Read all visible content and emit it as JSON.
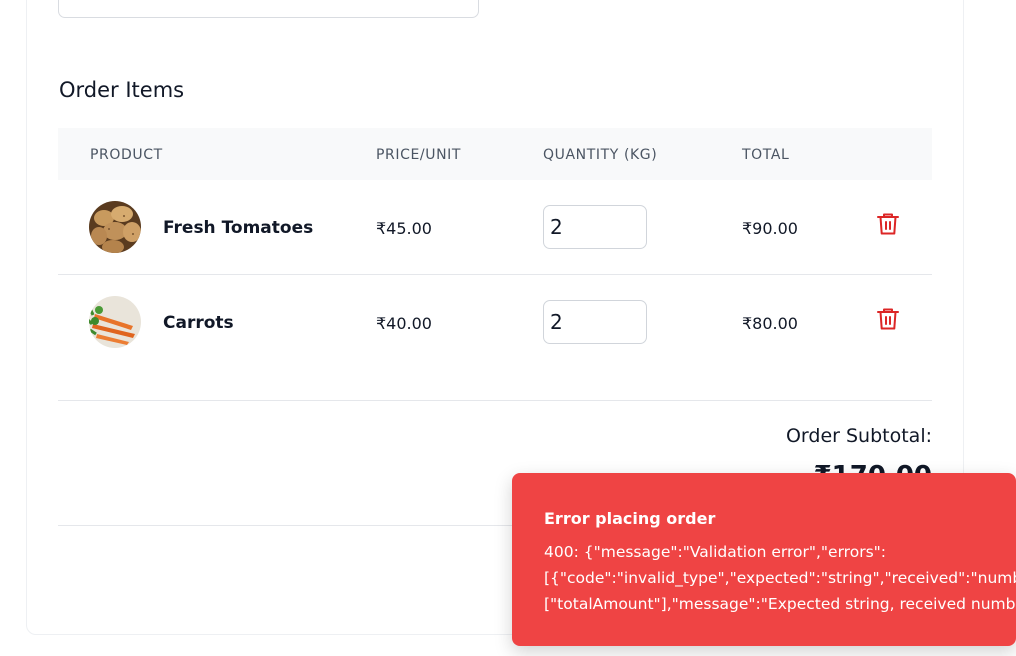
{
  "order_items": {
    "title": "Order Items",
    "columns": [
      "PRODUCT",
      "PRICE/UNIT",
      "QUANTITY (KG)",
      "TOTAL"
    ],
    "rows": [
      {
        "product": "Fresh Tomatoes",
        "image": "potatoes-image",
        "price": "₹45.00",
        "quantity": "2",
        "total": "₹90.00",
        "delete_icon": "trash-icon"
      },
      {
        "product": "Carrots",
        "image": "carrots-image",
        "price": "₹40.00",
        "quantity": "2",
        "total": "₹80.00",
        "delete_icon": "trash-icon"
      }
    ]
  },
  "summary": {
    "subtotal_label": "Order Subtotal:",
    "subtotal_value": "₹170.00"
  },
  "toast": {
    "title": "Error placing order",
    "lines": [
      "400: {\"message\":\"Validation error\",\"errors\":",
      "[{\"code\":\"invalid_type\",\"expected\":\"string\",\"received\":\"number\",\"path\":",
      "[\"totalAmount\"],\"message\":\"Expected string, received number\"}]}"
    ]
  },
  "colors": {
    "toast_bg": "#ef4444",
    "delete_icon": "#dc2626",
    "header_bg": "#f8f9fa"
  }
}
